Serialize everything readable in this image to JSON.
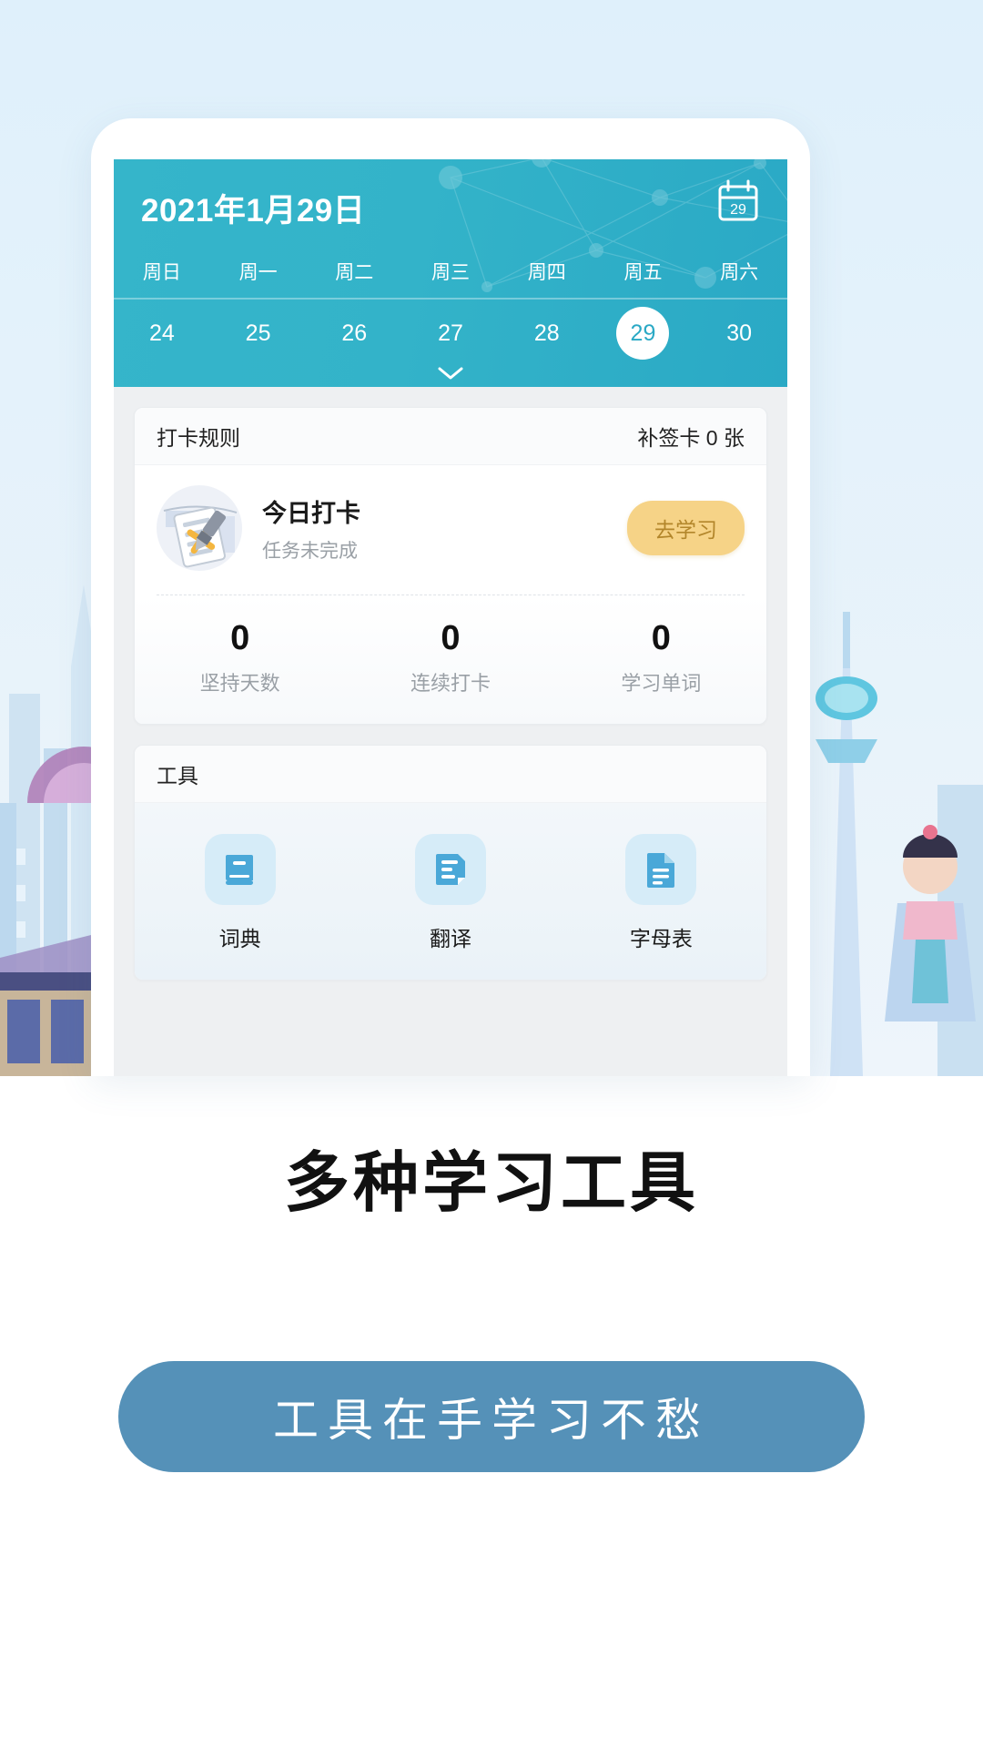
{
  "app": {
    "calendar": {
      "title": "2021年1月29日",
      "calendar_icon_day": "29",
      "weekdays": [
        "周日",
        "周一",
        "周二",
        "周三",
        "周四",
        "周五",
        "周六"
      ],
      "dates": [
        "24",
        "25",
        "26",
        "27",
        "28",
        "29",
        "30"
      ],
      "selected_date": "29",
      "expand_icon": "chevron-down-icon",
      "header_color": "#31b2c8"
    },
    "checkin_card": {
      "header_title": "打卡规则",
      "header_right": "补签卡 0 张",
      "task_title": "今日打卡",
      "task_status": "任务未完成",
      "action_button": "去学习",
      "action_button_color": "#f6d387",
      "stats": [
        {
          "value": "0",
          "label": "坚持天数"
        },
        {
          "value": "0",
          "label": "连续打卡"
        },
        {
          "value": "0",
          "label": "学习单词"
        }
      ]
    },
    "tools_card": {
      "header_title": "工具",
      "items": [
        {
          "label": "词典",
          "icon": "book-icon"
        },
        {
          "label": "翻译",
          "icon": "document-translate-icon"
        },
        {
          "label": "字母表",
          "icon": "document-text-icon"
        }
      ],
      "icon_color": "#4aa8d8",
      "icon_bg_color": "#d6ecf8"
    }
  },
  "promo": {
    "headline": "多种学习工具",
    "cta_label": "工具在手学习不愁",
    "cta_color": "#5591b8"
  }
}
